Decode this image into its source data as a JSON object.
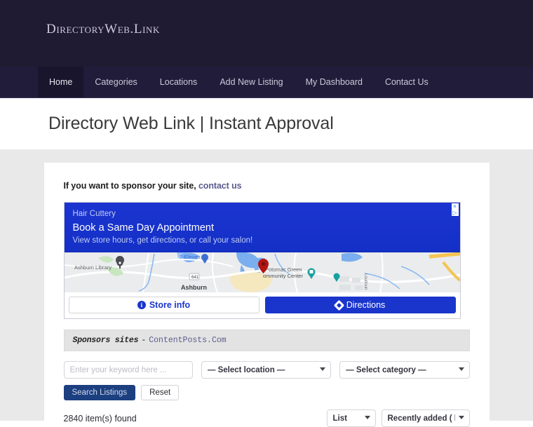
{
  "header": {
    "logo": "DirectoryWeb.Link",
    "background_color": "#1f1b33"
  },
  "nav": {
    "items": [
      {
        "label": "Home",
        "active": true
      },
      {
        "label": "Categories",
        "active": false
      },
      {
        "label": "Locations",
        "active": false
      },
      {
        "label": "Add New Listing",
        "active": false
      },
      {
        "label": "My Dashboard",
        "active": false
      },
      {
        "label": "Contact Us",
        "active": false
      }
    ]
  },
  "page": {
    "title": "Directory Web Link | Instant Approval"
  },
  "sponsor_notice": {
    "text": "If you want to sponsor your site,",
    "link_label": "contact us"
  },
  "advertisement": {
    "brand": "Hair Cuttery",
    "headline": "Book a Same Day Appointment",
    "subtext": "View store hours, get directions, or call your salon!",
    "accent_color": "#1a35cc",
    "adchoices_close": "×",
    "adchoices_arrow": "▷",
    "map": {
      "labels": [
        "Ashburn Library",
        "7-Eleven",
        "Potomac Green",
        "ommunity Center",
        "Ashburn",
        "Loudoun",
        "641"
      ]
    },
    "buttons": [
      {
        "label": "Store info",
        "style": "outline",
        "icon": "info-icon"
      },
      {
        "label": "Directions",
        "style": "filled",
        "icon": "directions-icon"
      }
    ]
  },
  "sponsors_strip": {
    "label": "Sponsors sites",
    "dash": "-",
    "link_label": "ContentPosts.Com"
  },
  "search": {
    "keyword_placeholder": "Enter your keyword here ...",
    "keyword_value": "",
    "location_selected": "— Select location —",
    "category_selected": "— Select category —",
    "search_button": "Search Listings",
    "reset_button": "Reset"
  },
  "results": {
    "count_label": "2840 item(s) found",
    "view_selected": "List",
    "sort_selected": "Recently added ( latest )"
  }
}
